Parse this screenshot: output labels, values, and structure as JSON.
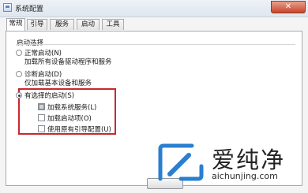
{
  "window": {
    "title": "系统配置",
    "close_glyph": "✕"
  },
  "tabs": [
    {
      "label": "常规",
      "active": true
    },
    {
      "label": "引导",
      "active": false
    },
    {
      "label": "服务",
      "active": false
    },
    {
      "label": "启动",
      "active": false
    },
    {
      "label": "工具",
      "active": false
    }
  ],
  "startup": {
    "group_label": "启动选择",
    "normal": {
      "label": "正常启动(N)",
      "desc": "加载所有设备驱动程序和服务",
      "selected": false
    },
    "diagnostic": {
      "label": "诊断启动(D)",
      "desc": "仅加载基本设备和服务",
      "selected": false
    },
    "selective": {
      "label": "有选择的启动(S)",
      "selected": true,
      "options": [
        {
          "label": "加载系统服务(L)",
          "checked": true
        },
        {
          "label": "加载启动项(O)",
          "checked": false
        },
        {
          "label": "使用原有引导配置(U)",
          "checked": false
        }
      ]
    }
  },
  "watermark": {
    "brand": "爱纯净",
    "url": "aichunjing.com"
  },
  "colors": {
    "highlight": "#c8282c",
    "accent": "#2a7fd0"
  }
}
